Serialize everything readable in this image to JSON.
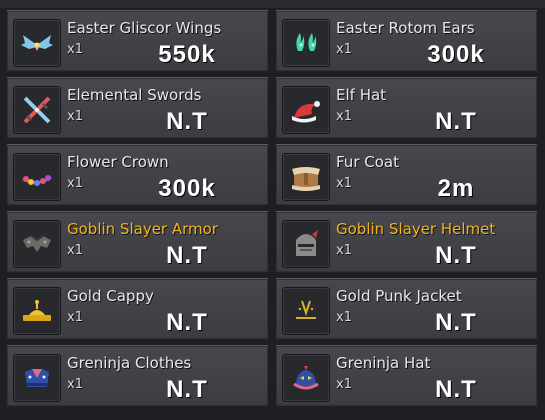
{
  "items": [
    {
      "name": "Easter Gliscor Wings",
      "qty": "x1",
      "price": "550k",
      "icon": "wings-icon",
      "highlight": false
    },
    {
      "name": "Easter Rotom Ears",
      "qty": "x1",
      "price": "300k",
      "icon": "ears-icon",
      "highlight": false
    },
    {
      "name": "Elemental Swords",
      "qty": "x1",
      "price": "N.T",
      "icon": "swords-icon",
      "highlight": false
    },
    {
      "name": "Elf Hat",
      "qty": "x1",
      "price": "N.T",
      "icon": "elf-hat-icon",
      "highlight": false
    },
    {
      "name": "Flower Crown",
      "qty": "x1",
      "price": "300k",
      "icon": "flower-crown-icon",
      "highlight": false
    },
    {
      "name": "Fur Coat",
      "qty": "x1",
      "price": "2m",
      "icon": "fur-coat-icon",
      "highlight": false
    },
    {
      "name": "Goblin Slayer Armor",
      "qty": "x1",
      "price": "N.T",
      "icon": "armor-icon",
      "highlight": true
    },
    {
      "name": "Goblin Slayer Helmet",
      "qty": "x1",
      "price": "N.T",
      "icon": "helmet-icon",
      "highlight": true
    },
    {
      "name": "Gold Cappy",
      "qty": "x1",
      "price": "N.T",
      "icon": "cap-icon",
      "highlight": false
    },
    {
      "name": "Gold Punk Jacket",
      "qty": "x1",
      "price": "N.T",
      "icon": "jacket-icon",
      "highlight": false
    },
    {
      "name": "Greninja Clothes",
      "qty": "x1",
      "price": "N.T",
      "icon": "clothes-icon",
      "highlight": false
    },
    {
      "name": "Greninja Hat",
      "qty": "x1",
      "price": "N.T",
      "icon": "greninja-hat-icon",
      "highlight": false
    }
  ],
  "colors": {
    "normal_name": "#e8e8e8",
    "highlight_name": "#f2b420",
    "price": "#ffffff"
  }
}
